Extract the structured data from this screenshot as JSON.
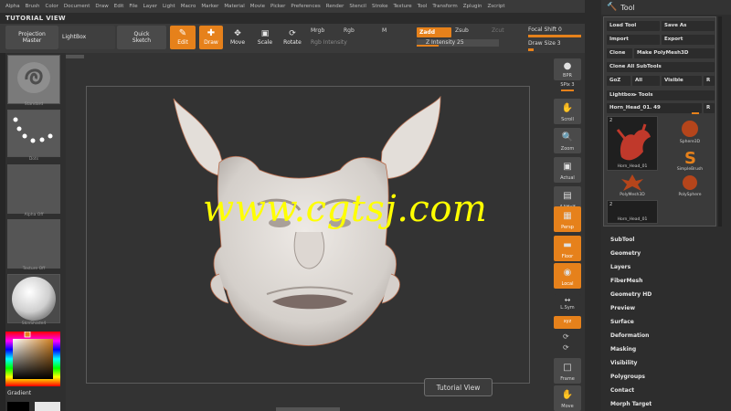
{
  "menubar": {
    "items": [
      "Alpha",
      "Brush",
      "Color",
      "Document",
      "Draw",
      "Edit",
      "File",
      "Layer",
      "Light",
      "Macro",
      "Marker",
      "Material",
      "Movie",
      "Picker",
      "Preferences",
      "Render",
      "Stencil",
      "Stroke",
      "Texture",
      "Tool",
      "Transform",
      "Zplugin",
      "Zscript"
    ]
  },
  "document": {
    "title": "TUTORIAL VIEW"
  },
  "toolbar": {
    "projection_master": "Projection Master",
    "lightbox": "LightBox",
    "quick_sketch": "Quick Sketch",
    "edit": "Edit",
    "draw": "Draw",
    "move": "Move",
    "scale": "Scale",
    "rotate": "Rotate",
    "mrgb": "Mrgb",
    "rgb": "Rgb",
    "m": "M",
    "rgb_intensity": "Rgb Intensity",
    "zadd": "Zadd",
    "zsub": "Zsub",
    "zcut": "Zcut",
    "z_intensity": "Z Intensity 25",
    "focal_shift": "Focal Shift 0",
    "draw_size": "Draw Size 3"
  },
  "left_panel": {
    "thumbs": [
      {
        "label": "Standard"
      },
      {
        "label": "Dots"
      },
      {
        "label": "Alpha Off"
      },
      {
        "label": "Texture Off"
      },
      {
        "label": "SkinShade4"
      }
    ],
    "gradient": "Gradient"
  },
  "right_shelf": {
    "bpr": "BPR",
    "spix": "SPix 3",
    "scroll": "Scroll",
    "zoom": "Zoom",
    "actual": "Actual",
    "aahalf": "AAHalf",
    "persp": "Persp",
    "floor": "Floor",
    "local": "Local",
    "lsym": "L.Sym",
    "xyz": "xyz",
    "frame": "Frame",
    "move": "Move"
  },
  "tooltip": {
    "text": "Tutorial View"
  },
  "watermark": {
    "text": "www.cgtsj.com"
  },
  "tool_panel": {
    "title": "Tool",
    "load_tool": "Load Tool",
    "save_as": "Save As",
    "import": "Import",
    "export": "Export",
    "clone": "Clone",
    "make_polymesh": "Make PolyMesh3D",
    "clone_all": "Clone All SubTools",
    "goz": "GoZ",
    "all": "All",
    "visible": "Visible",
    "r": "R",
    "lightbox_tools": "Lightbox▸ Tools",
    "current_tool": "Horn_Head_01. 49",
    "r2": "R",
    "sub_tools": [
      {
        "label": "Horn_Head_01"
      },
      {
        "label": "Sphere3D"
      },
      {
        "label": "SimpleBrush"
      },
      {
        "label": "PolyMesh3D"
      },
      {
        "label": "PolySphere"
      },
      {
        "label": "Horn_Head_01"
      }
    ],
    "badge_2": "2",
    "menus": [
      "SubTool",
      "Geometry",
      "Layers",
      "FiberMesh",
      "Geometry HD",
      "Preview",
      "Surface",
      "Deformation",
      "Masking",
      "Visibility",
      "Polygroups",
      "Contact",
      "Morph Target"
    ]
  },
  "colors": {
    "accent": "#e6811b",
    "background": "#2b2b2b",
    "watermark": "#ffff00"
  }
}
